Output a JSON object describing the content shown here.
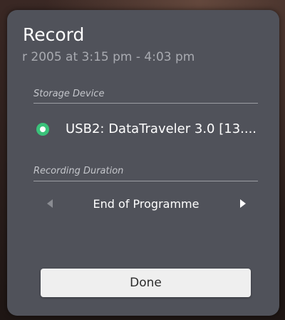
{
  "dialog": {
    "title": "Record",
    "subtitle": "r 2005 at 3:15 pm - 4:03 pm"
  },
  "storage": {
    "label": "Storage Device",
    "selected_device": "USB2: DataTraveler 3.0 [13....",
    "radio_color": "#3ac27a"
  },
  "duration": {
    "label": "Recording Duration",
    "value": "End of Programme",
    "prev_icon": "chevron-left-icon",
    "next_icon": "chevron-right-icon"
  },
  "actions": {
    "done_label": "Done"
  }
}
